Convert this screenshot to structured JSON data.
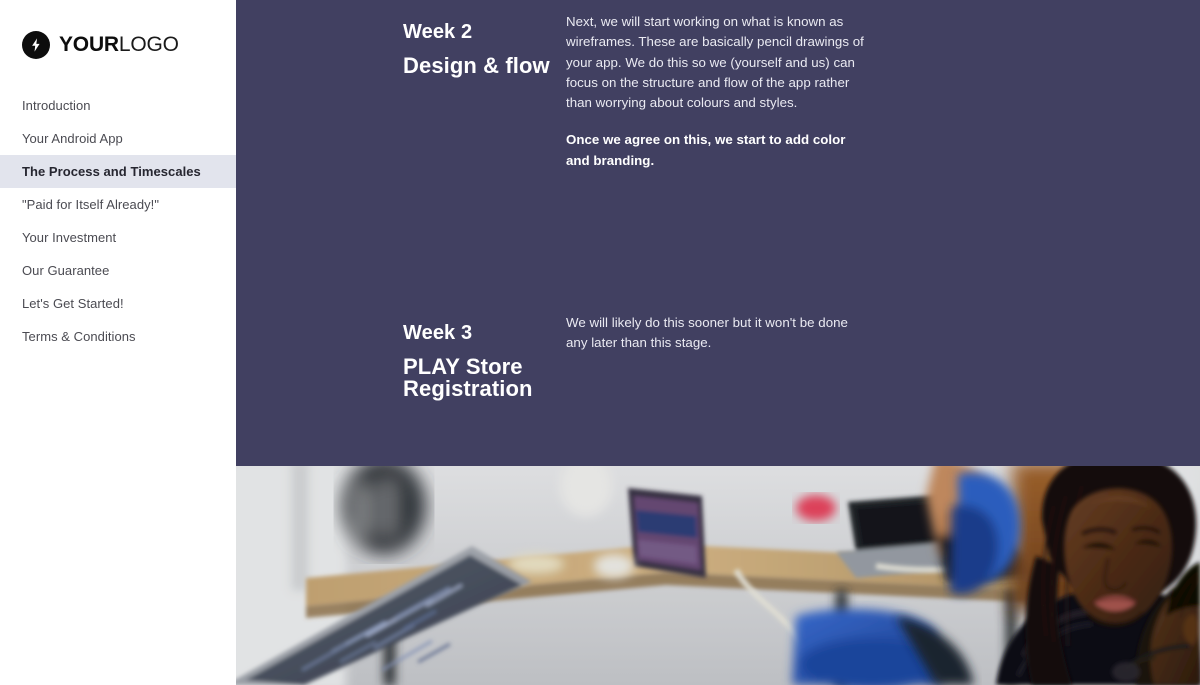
{
  "brand": {
    "logo_icon": "lightning-bolt-icon",
    "name_bold": "YOUR",
    "name_light": "LOGO"
  },
  "sidebar": {
    "items": [
      {
        "label": "Introduction",
        "active": false
      },
      {
        "label": "Your Android App",
        "active": false
      },
      {
        "label": "The Process and Timescales",
        "active": true
      },
      {
        "label": "\"Paid for Itself Already!\"",
        "active": false
      },
      {
        "label": "Your Investment",
        "active": false
      },
      {
        "label": "Our Guarantee",
        "active": false
      },
      {
        "label": "Let's Get Started!",
        "active": false
      },
      {
        "label": "Terms & Conditions",
        "active": false
      }
    ]
  },
  "main": {
    "panel_color": "#414061",
    "sections": [
      {
        "kicker": "Week 2",
        "title": "Design & flow",
        "body": "Next, we will start working on what is known as wireframes. These are basically pencil drawings of your app. We do this so we (yourself and us) can focus on the structure and flow of the app rather than worrying about colours and styles.",
        "body_strong": "Once we agree on this, we start to add color and branding."
      },
      {
        "kicker": "Week 3",
        "title": "PLAY Store Registration",
        "body": "We will likely do this sooner but it won't be done any later than this stage.",
        "body_strong": ""
      }
    ]
  },
  "photo": {
    "alt": "Two colleagues collaborating at a desk in an open-plan office with laptops"
  }
}
